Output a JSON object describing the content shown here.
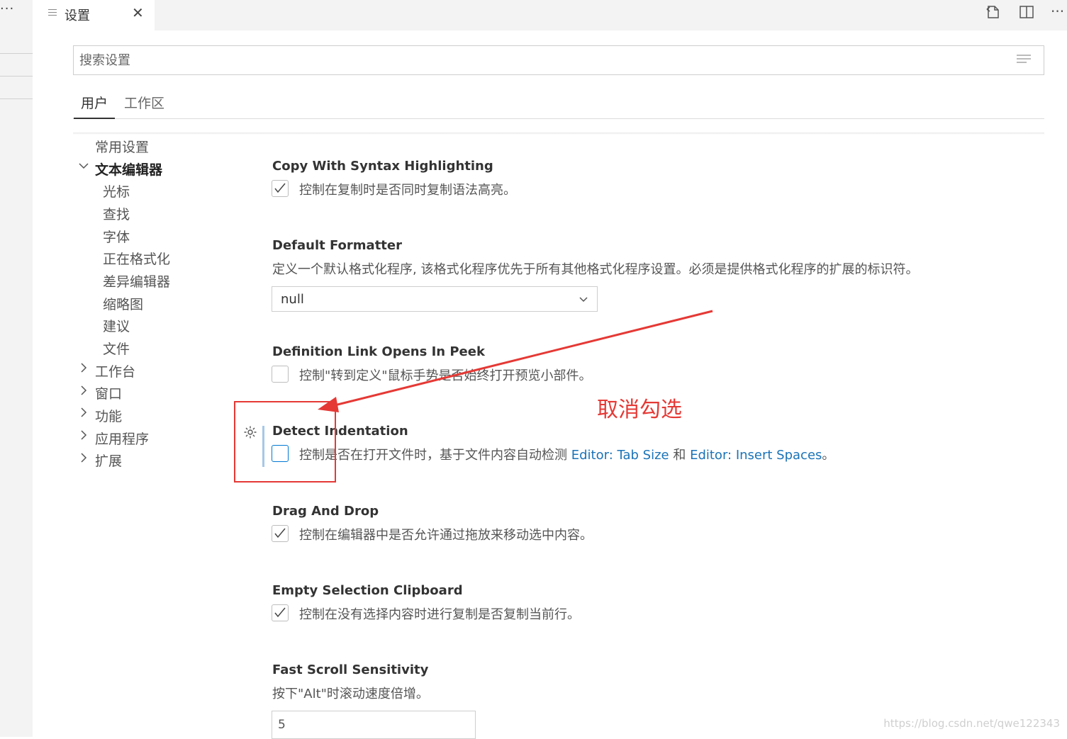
{
  "window": {
    "left_strip_more": "···"
  },
  "tabbar": {
    "tab_title": "设置",
    "close_glyph": "✕",
    "actions": {
      "open_json_icon": "open-settings-json-icon",
      "split_editor_icon": "split-editor-icon",
      "more_actions": "···"
    }
  },
  "search": {
    "placeholder": "搜索设置",
    "value": ""
  },
  "scope_tabs": {
    "user": "用户",
    "workspace": "工作区",
    "active": "user"
  },
  "toc": {
    "common": "常用设置",
    "text_editor": "文本编辑器",
    "text_editor_children": [
      "光标",
      "查找",
      "字体",
      "正在格式化",
      "差异编辑器",
      "缩略图",
      "建议",
      "文件"
    ],
    "collapsed": [
      "工作台",
      "窗口",
      "功能",
      "应用程序",
      "扩展"
    ],
    "chevron_expanded": "﹀",
    "chevron_collapsed": "›"
  },
  "settings": {
    "copy_with_syntax": {
      "title": "Copy With Syntax Highlighting",
      "desc": "控制在复制时是否同时复制语法高亮。",
      "checked": true
    },
    "default_formatter": {
      "title": "Default Formatter",
      "desc": "定义一个默认格式化程序, 该格式化程序优先于所有其他格式化程序设置。必须是提供格式化程序的扩展的标识符。",
      "value": "null"
    },
    "definition_link": {
      "title": "Definition Link Opens In Peek",
      "desc": "控制\"转到定义\"鼠标手势是否始终打开预览小部件。",
      "checked": false
    },
    "detect_indentation": {
      "title": "Detect Indentation",
      "desc_prefix": "控制是否在打开文件时，基于文件内容自动检测 ",
      "link1": "Editor: Tab Size",
      "desc_mid": " 和 ",
      "link2": "Editor: Insert Spaces",
      "desc_suffix": "。",
      "checked": false
    },
    "drag_and_drop": {
      "title": "Drag And Drop",
      "desc": "控制在编辑器中是否允许通过拖放来移动选中内容。",
      "checked": true
    },
    "empty_selection": {
      "title": "Empty Selection Clipboard",
      "desc": "控制在没有选择内容时进行复制是否复制当前行。",
      "checked": true
    },
    "fast_scroll": {
      "title": "Fast Scroll Sensitivity",
      "desc": "按下\"Alt\"时滚动速度倍增。",
      "value": "5"
    }
  },
  "annotation": {
    "label": "取消勾选",
    "color": "#e53935"
  },
  "watermark": "https://blog.csdn.net/qwe122343",
  "colors": {
    "link": "#1a73b8",
    "focus_border": "#0078d4",
    "annotation_red": "#e53935"
  }
}
